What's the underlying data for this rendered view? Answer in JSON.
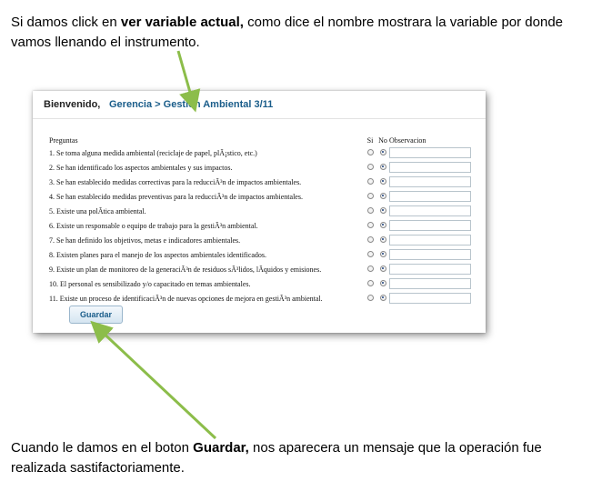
{
  "intro": {
    "pre": "Si damos click en ",
    "bold": "ver variable actual,",
    "post": " como dice el nombre mostrara la variable por donde vamos llenando el instrumento."
  },
  "header": {
    "welcome": "Bienvenido,",
    "crumb_parent": "Gerencia",
    "crumb_sep": " > ",
    "crumb_current": "Gestion Ambiental 3/11"
  },
  "table": {
    "headers": {
      "questions": "Preguntas",
      "si": "Si",
      "no": "No",
      "obs": "Observacion"
    },
    "rows": [
      {
        "text": "1. Se toma alguna medida ambiental (reciclaje de papel, plÃ¡stico, etc.)"
      },
      {
        "text": "2. Se han identificado los aspectos ambientales y sus impactos."
      },
      {
        "text": "3. Se han establecido medidas correctivas para la reducciÃ³n de impactos ambientales."
      },
      {
        "text": "4. Se han establecido medidas preventivas para la reducciÃ³n de impactos ambientales."
      },
      {
        "text": "5. Existe una polÃtica ambiental."
      },
      {
        "text": "6. Existe un responsable o equipo de trabajo para la gestiÃ³n ambiental."
      },
      {
        "text": "7. Se han definido los objetivos, metas e indicadores ambientales."
      },
      {
        "text": "8. Existen planes para el manejo de los aspectos ambientales identificados."
      },
      {
        "text": "9. Existe un plan de monitoreo de la generaciÃ³n de residuos sÃ³lidos, lÃquidos y emisiones."
      },
      {
        "text": "10. El personal es sensibilizado y/o capacitado en temas ambientales."
      },
      {
        "text": "11. Existe un proceso de identificaciÃ³n de nuevas opciones de mejora en gestiÃ³n ambiental."
      }
    ],
    "selected": "No"
  },
  "save_label": "Guardar",
  "outro": {
    "pre": "Cuando le damos en el boton ",
    "bold": "Guardar,",
    "post": " nos aparecera un mensaje que la operación fue realizada sastifactoriamente."
  },
  "colors": {
    "link": "#1a5d8a",
    "arrow": "#8cbd4a"
  }
}
